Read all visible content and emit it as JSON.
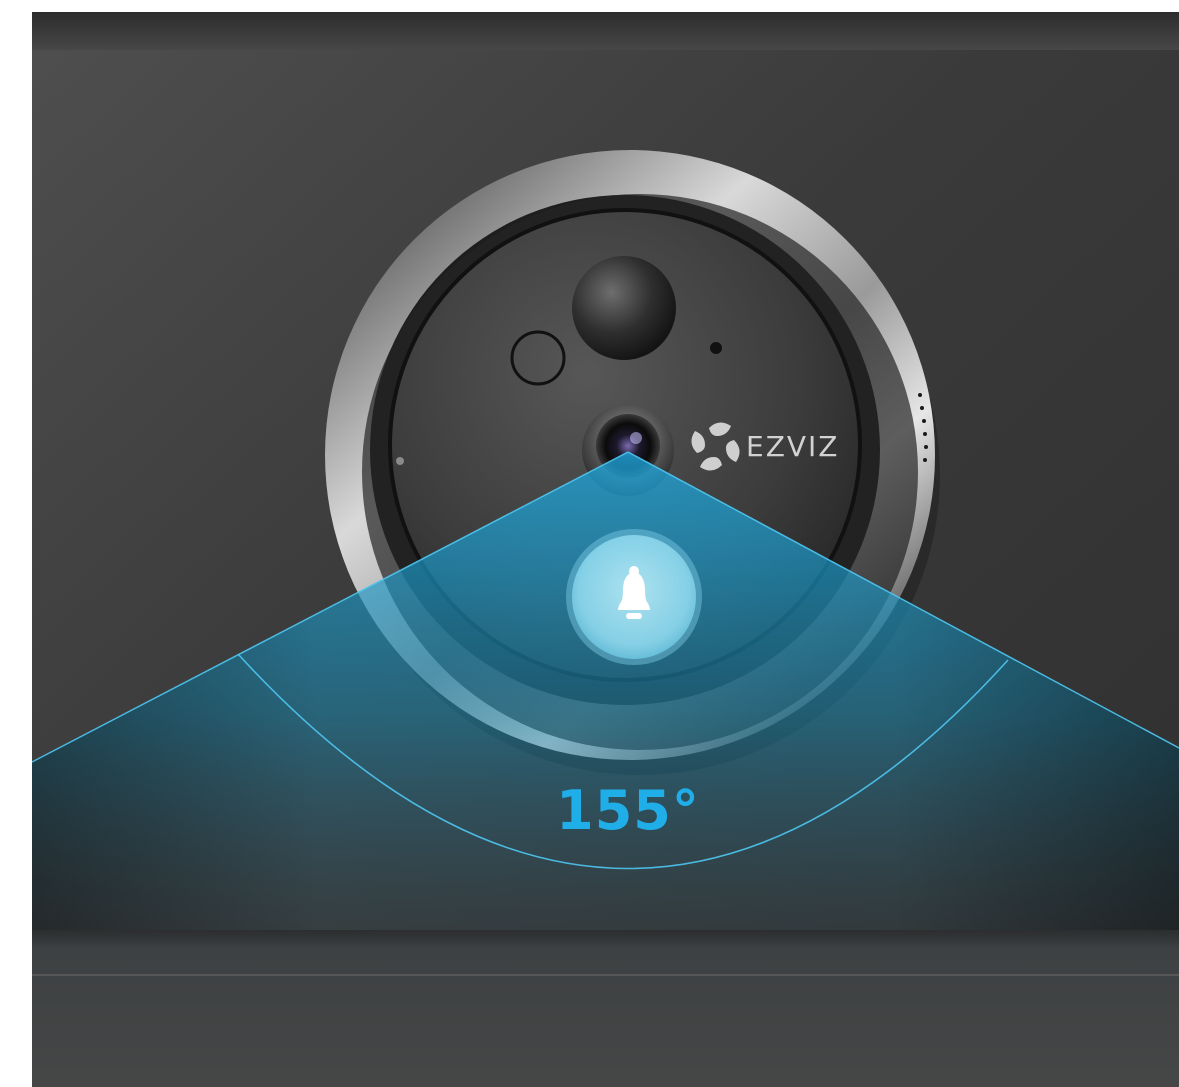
{
  "product": {
    "brand_name": "EZVIZ",
    "field_of_view_label": "155°"
  },
  "icons": {
    "doorbell_button": "bell-icon",
    "brand_logo": "fan-logo-icon"
  },
  "colors": {
    "wall": "#3f3f3f",
    "field_of_view": "#1c9fd3",
    "field_of_view_line": "#4ec7f2",
    "angle_text": "#1faee8",
    "bell_button": "#a7e6f4",
    "bezel": "#2a2a2a",
    "silver_ring": "#cfcfcf"
  }
}
